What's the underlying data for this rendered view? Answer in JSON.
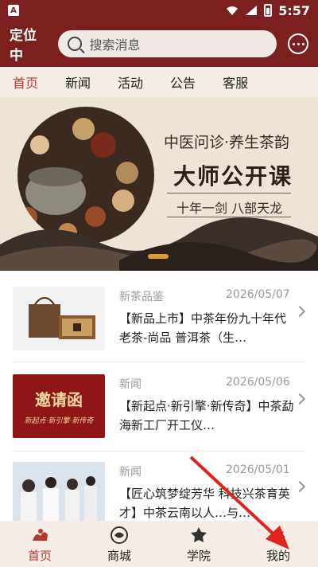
{
  "status": {
    "time": "5:57",
    "app_icon_letter": "A"
  },
  "header": {
    "location": "定位中",
    "search_placeholder": "搜索消息"
  },
  "tabs": [
    {
      "label": "首页",
      "active": true
    },
    {
      "label": "新闻",
      "active": false
    },
    {
      "label": "活动",
      "active": false
    },
    {
      "label": "公告",
      "active": false
    },
    {
      "label": "客服",
      "active": false
    }
  ],
  "banner": {
    "line1": "中医问诊·养生茶韵",
    "line2": "大师公开课",
    "line3": "十年一剑 八部天龙"
  },
  "news": [
    {
      "category": "新茶品鉴",
      "date": "2026/05/07",
      "title": "【新品上市】中茶年份九十年代老茶-尚品 普洱茶（生…"
    },
    {
      "category": "新闻",
      "date": "2026/05/06",
      "title": "【新起点·新引擎·新传奇】中茶勐海新工厂开工仪…",
      "thumb_text_main": "邀请函",
      "thumb_text_sub": "新起点·新引擎·新传奇"
    },
    {
      "category": "新闻",
      "date": "2026/05/01",
      "title": "【匠心筑梦绽芳华 科技兴茶育英才】中茶云南以人…与…"
    }
  ],
  "bottom_nav": [
    {
      "label": "首页",
      "active": true
    },
    {
      "label": "商城",
      "active": false
    },
    {
      "label": "学院",
      "active": false
    },
    {
      "label": "我的",
      "active": false
    }
  ],
  "colors": {
    "brand": "#7b1f1f",
    "accent": "#c0392b",
    "annotation": "#e0231f"
  }
}
